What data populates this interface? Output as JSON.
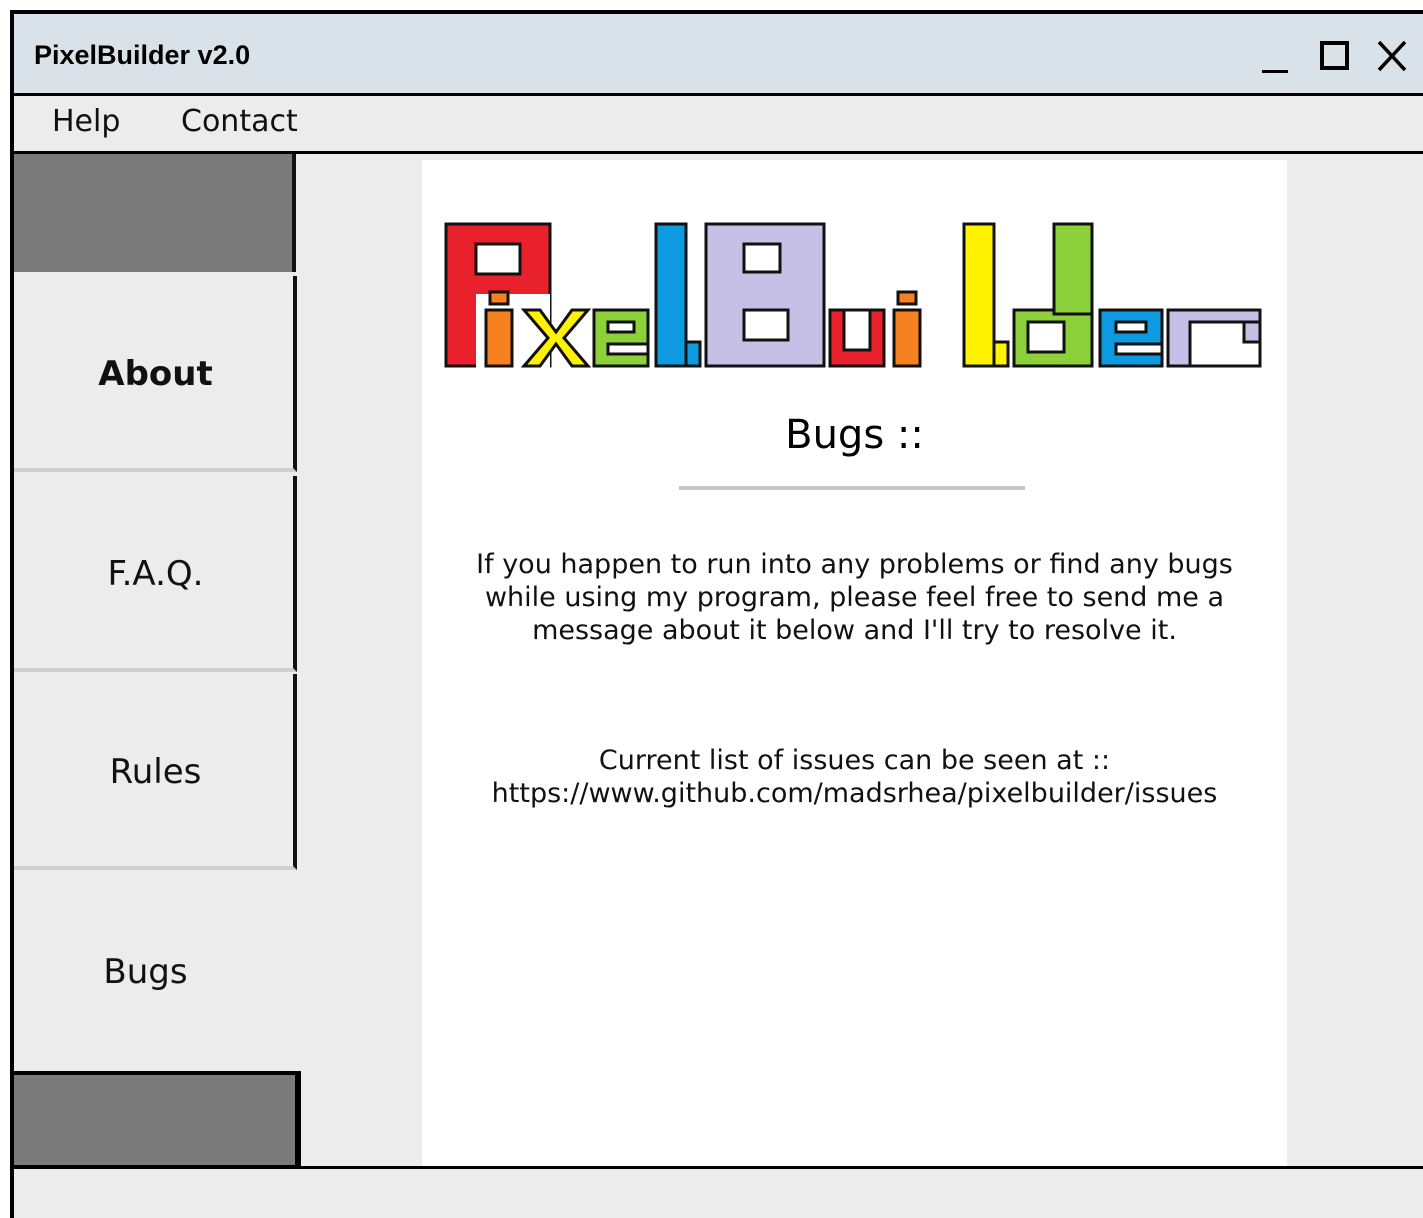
{
  "window": {
    "title": "PixelBuilder v2.0",
    "controls": {
      "minimize": "minimize-icon",
      "maximize": "maximize-icon",
      "close": "close-icon"
    }
  },
  "menu": {
    "items": [
      {
        "label": "Help"
      },
      {
        "label": "Contact"
      }
    ]
  },
  "sidebar": {
    "tabs": [
      {
        "label": "About"
      },
      {
        "label": "F.A.Q."
      },
      {
        "label": "Rules"
      },
      {
        "label": "Bugs",
        "active": true
      }
    ]
  },
  "content": {
    "logo_text": "PixelBuilder",
    "logo_colors": [
      "#e8212c",
      "#f5821f",
      "#fff200",
      "#8cd13a",
      "#0d9ae0",
      "#c6bfe6"
    ],
    "section_title": "Bugs ::",
    "paragraph_1": "If you happen to run into any problems or find any bugs while using my program, please feel free to send me a message about it below and I'll try to resolve it.",
    "paragraph_2_line_1": "Current list of issues can be seen at ::",
    "paragraph_2_line_2": "https://www.github.com/madsrhea/pixelbuilder/issues"
  }
}
